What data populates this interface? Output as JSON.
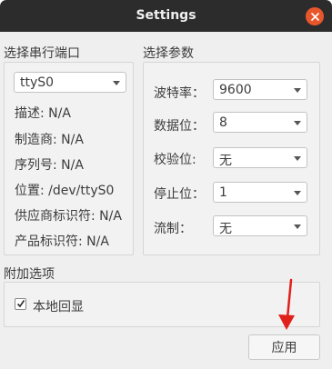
{
  "window": {
    "title": "Settings"
  },
  "port_group": {
    "title": "选择串行端口",
    "selected_port": "ttyS0",
    "description": "描述: N/A",
    "manufacturer": "制造商: N/A",
    "serial_number": "序列号: N/A",
    "location": "位置: /dev/ttyS0",
    "vendor_id": "供应商标识符: N/A",
    "product_id": "产品标识符: N/A"
  },
  "params_group": {
    "title": "选择参数",
    "baud_label": "波特率：",
    "baud_value": "9600",
    "data_bits_label": "数据位：",
    "data_bits_value": "8",
    "parity_label": "校验位:",
    "parity_value": "无",
    "stop_bits_label": "停止位：",
    "stop_bits_value": "1",
    "flow_label": "流制：",
    "flow_value": "无"
  },
  "extra_group": {
    "title": "附加选项",
    "local_echo_label": "本地回显",
    "local_echo_checked": true
  },
  "apply_label": "应用",
  "annotation_color": "#e0201a"
}
